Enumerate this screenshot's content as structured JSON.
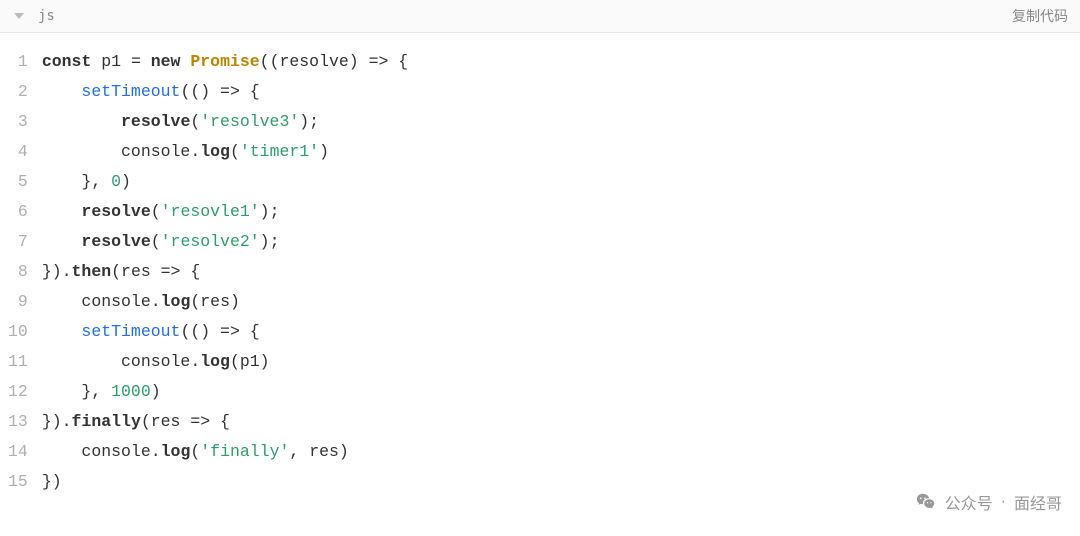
{
  "header": {
    "language": "js",
    "copy_label": "复制代码"
  },
  "code": {
    "lines": [
      [
        {
          "t": "const ",
          "c": "kw"
        },
        {
          "t": "p1 = "
        },
        {
          "t": "new ",
          "c": "kw"
        },
        {
          "t": "Promise",
          "c": "cls"
        },
        {
          "t": "((resolve) => {"
        }
      ],
      [
        {
          "t": "    "
        },
        {
          "t": "setTimeout",
          "c": "fn"
        },
        {
          "t": "(() => {"
        }
      ],
      [
        {
          "t": "        "
        },
        {
          "t": "resolve",
          "c": "mth"
        },
        {
          "t": "("
        },
        {
          "t": "'resolve3'",
          "c": "str"
        },
        {
          "t": ");"
        }
      ],
      [
        {
          "t": "        console."
        },
        {
          "t": "log",
          "c": "mth"
        },
        {
          "t": "("
        },
        {
          "t": "'timer1'",
          "c": "str"
        },
        {
          "t": ")"
        }
      ],
      [
        {
          "t": "    }, "
        },
        {
          "t": "0",
          "c": "num"
        },
        {
          "t": ")"
        }
      ],
      [
        {
          "t": "    "
        },
        {
          "t": "resolve",
          "c": "mth"
        },
        {
          "t": "("
        },
        {
          "t": "'resovle1'",
          "c": "str"
        },
        {
          "t": ");"
        }
      ],
      [
        {
          "t": "    "
        },
        {
          "t": "resolve",
          "c": "mth"
        },
        {
          "t": "("
        },
        {
          "t": "'resolve2'",
          "c": "str"
        },
        {
          "t": ");"
        }
      ],
      [
        {
          "t": "})."
        },
        {
          "t": "then",
          "c": "mth"
        },
        {
          "t": "(res => {"
        }
      ],
      [
        {
          "t": "    console."
        },
        {
          "t": "log",
          "c": "mth"
        },
        {
          "t": "(res)"
        }
      ],
      [
        {
          "t": "    "
        },
        {
          "t": "setTimeout",
          "c": "fn"
        },
        {
          "t": "(() => {"
        }
      ],
      [
        {
          "t": "        console."
        },
        {
          "t": "log",
          "c": "mth"
        },
        {
          "t": "(p1)"
        }
      ],
      [
        {
          "t": "    }, "
        },
        {
          "t": "1000",
          "c": "num"
        },
        {
          "t": ")"
        }
      ],
      [
        {
          "t": "})."
        },
        {
          "t": "finally",
          "c": "mth"
        },
        {
          "t": "(res => {"
        }
      ],
      [
        {
          "t": "    console."
        },
        {
          "t": "log",
          "c": "mth"
        },
        {
          "t": "("
        },
        {
          "t": "'finally'",
          "c": "str"
        },
        {
          "t": ", res)"
        }
      ],
      [
        {
          "t": "})"
        }
      ]
    ]
  },
  "watermark": {
    "label1": "公众号",
    "separator": "·",
    "label2": "面经哥"
  }
}
